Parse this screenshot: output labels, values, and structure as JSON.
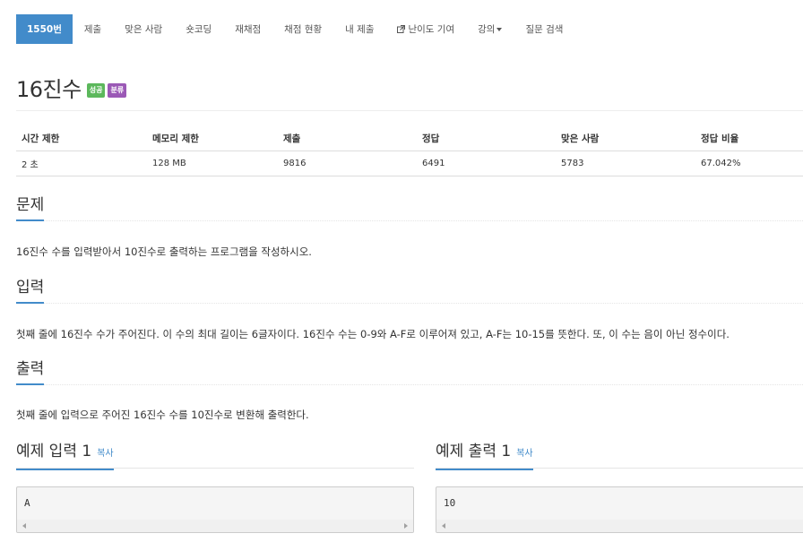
{
  "nav": {
    "items": [
      {
        "label": "1550번",
        "active": true
      },
      {
        "label": "제출"
      },
      {
        "label": "맞은 사람"
      },
      {
        "label": "숏코딩"
      },
      {
        "label": "재채점"
      },
      {
        "label": "채점 현황"
      },
      {
        "label": "내 제출"
      },
      {
        "label": "난이도 기여",
        "icon": "external-link-icon"
      },
      {
        "label": "강의",
        "icon": "caret-down-icon"
      },
      {
        "label": "질문 검색"
      }
    ]
  },
  "problem": {
    "title": "16진수",
    "badges": [
      {
        "label": "성공",
        "color": "#5cb85c"
      },
      {
        "label": "분류",
        "color": "#9b59b6"
      }
    ]
  },
  "info_table": {
    "headers": [
      "시간 제한",
      "메모리 제한",
      "제출",
      "정답",
      "맞은 사람",
      "정답 비율"
    ],
    "row": [
      "2 초",
      "128 MB",
      "9816",
      "6491",
      "5783",
      "67.042%"
    ]
  },
  "sections": {
    "description": {
      "heading": "문제",
      "text": "16진수 수를 입력받아서 10진수로 출력하는 프로그램을 작성하시오."
    },
    "input": {
      "heading": "입력",
      "text": "첫째 줄에 16진수 수가 주어진다. 이 수의 최대 길이는 6글자이다. 16진수 수는 0-9와 A-F로 이루어져 있고, A-F는 10-15를 뜻한다. 또, 이 수는 음이 아닌 정수이다."
    },
    "output": {
      "heading": "출력",
      "text": "첫째 줄에 입력으로 주어진 16진수 수를 10진수로 변환해 출력한다."
    }
  },
  "samples": {
    "input": {
      "heading": "예제 입력 1",
      "copy_label": "복사",
      "content": "A"
    },
    "output": {
      "heading": "예제 출력 1",
      "copy_label": "복사",
      "content": "10"
    }
  },
  "colors": {
    "primary": "#428bca",
    "success": "#5cb85c",
    "category": "#9b59b6"
  }
}
